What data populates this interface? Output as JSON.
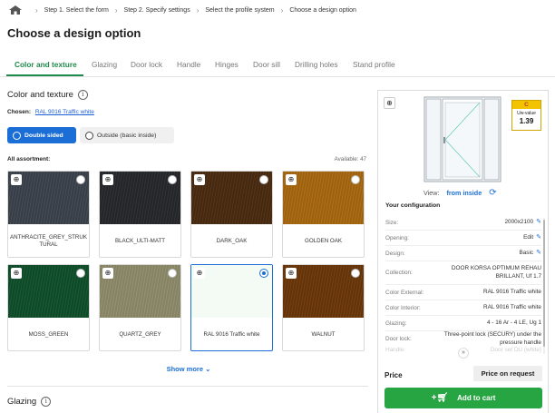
{
  "breadcrumb": {
    "items": [
      "Step 1. Select the form",
      "Step 2. Specify settings",
      "Select the profile system",
      "Choose a design option"
    ]
  },
  "page_title": "Choose a design option",
  "tabs": [
    {
      "label": "Color and texture",
      "active": true
    },
    {
      "label": "Glazing",
      "active": false
    },
    {
      "label": "Door lock",
      "active": false
    },
    {
      "label": "Handle",
      "active": false
    },
    {
      "label": "Hinges",
      "active": false
    },
    {
      "label": "Door sill",
      "active": false
    },
    {
      "label": "Drilling holes",
      "active": false
    },
    {
      "label": "Stand profile",
      "active": false
    }
  ],
  "color_section": {
    "title": "Color and texture",
    "chosen_label": "Chosen:",
    "chosen_value": "RAL 9016 Traffic white",
    "toggle_on": "Double sided",
    "toggle_off": "Outside (basic inside)",
    "all_assortment": "All assortment:",
    "available": "Available: 47",
    "swatches": [
      {
        "name": "ANTHRACITE_GREY_STRUKTURAL",
        "color": "#3b424b",
        "selected": false
      },
      {
        "name": "BLACK_ULTI-MATT",
        "color": "#26272b",
        "selected": false
      },
      {
        "name": "DARK_OAK",
        "color": "#4a2a10",
        "selected": false
      },
      {
        "name": "GOLDEN OAK",
        "color": "#a8670f",
        "selected": false
      },
      {
        "name": "MOSS_GREEN",
        "color": "#0f4f2a",
        "selected": false
      },
      {
        "name": "QUARTZ_GREY",
        "color": "#8d8b6a",
        "selected": false
      },
      {
        "name": "RAL 9016 Traffic white",
        "color": "#f4fbf4",
        "selected": true
      },
      {
        "name": "WALNUT",
        "color": "#6a3608",
        "selected": false
      }
    ],
    "show_more": "Show more"
  },
  "glazing_section": {
    "title": "Glazing"
  },
  "preview": {
    "uw_class": "C",
    "uw_label": "Uw-value",
    "uw_value": "1.39",
    "view_label": "View:",
    "view_value": "from inside"
  },
  "configuration": {
    "title": "Your configuration",
    "rows": [
      {
        "label": "Size:",
        "value": "2000x2100",
        "edit": true
      },
      {
        "label": "Opening:",
        "value": "Edit",
        "edit": true
      },
      {
        "label": "Design:",
        "value": "Basic",
        "edit": true
      },
      {
        "label": "Collection:",
        "value": "DOOR KORSA OPTIMUM REHAU BRILLANT, Uf 1.7",
        "edit": false
      },
      {
        "label": "Color External:",
        "value": "RAL 9016 Traffic white",
        "edit": false
      },
      {
        "label": "Color Interior:",
        "value": "RAL 9016 Traffic white",
        "edit": false
      },
      {
        "label": "Glazing:",
        "value": "4 - 16 Ar - 4 LE, Ug 1",
        "edit": false
      },
      {
        "label": "Door lock:",
        "value": "Three-point lock (SECURY) under the pressure handle",
        "edit": false
      }
    ],
    "faded_row": {
      "label": "Handle:",
      "value": "Door set DU (white)"
    }
  },
  "price": {
    "label": "Price",
    "value": "Price on request",
    "cart_button": "Add to cart"
  },
  "colors": {
    "accent_green": "#1f8a4c",
    "primary_blue": "#1b6ed6",
    "cart_green": "#27a543"
  }
}
